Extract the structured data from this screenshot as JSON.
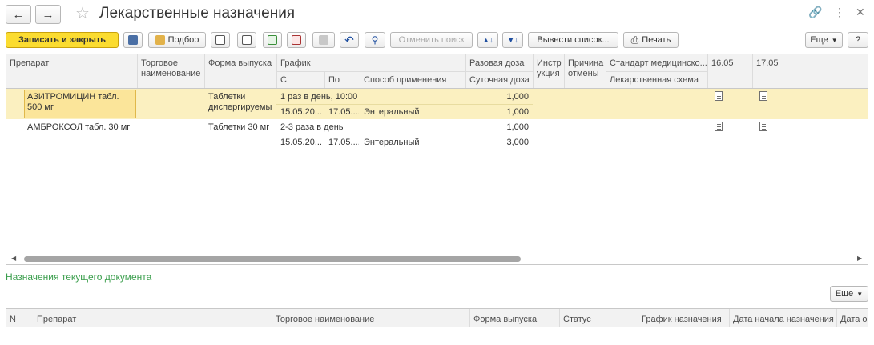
{
  "window": {
    "title": "Лекарственные назначения",
    "back_icon": "arrow-left",
    "forward_icon": "arrow-right",
    "link_icon": "link",
    "menu_icon": "kebab",
    "close_icon": "close"
  },
  "toolbar": {
    "save_close": "Записать и закрыть",
    "podbor": "Подбор",
    "cancel_search": "Отменить поиск",
    "show_list": "Вывести список...",
    "print": "Печать",
    "more": "Еще",
    "help": "?"
  },
  "main_table": {
    "headers": {
      "drug": "Препарат",
      "trade_name": "Торговое наименование",
      "form": "Форма выпуска",
      "schedule": "График",
      "from": "С",
      "to": "По",
      "method": "Способ применения",
      "single_dose": "Разовая доза",
      "daily_dose": "Суточная доза",
      "instruction": "Инстр укция",
      "cancel_reason": "Причина отмены",
      "standard": "Стандарт медицинско...",
      "drug_scheme": "Лекарственная схема",
      "date1": "16.05",
      "date2": "17.05"
    },
    "rows": [
      {
        "drug": "АЗИТРОМИЦИН табл. 500 мг",
        "form": "Таблетки диспергируемы",
        "schedule": "1 раз в день, 10:00",
        "from": "15.05.20...",
        "to": "17.05....",
        "method": "Энтеральный",
        "single_dose": "1,000",
        "daily_dose": "1,000"
      },
      {
        "drug": "АМБРОКСОЛ табл. 30 мг",
        "form": "Таблетки 30 мг",
        "schedule": "2-3 раза в день",
        "from": "15.05.20...",
        "to": "17.05....",
        "method": "Энтеральный",
        "single_dose": "1,000",
        "daily_dose": "3,000"
      }
    ]
  },
  "section_title": "Назначения текущего документа",
  "second_table": {
    "more": "Еще",
    "headers": [
      "N",
      "Препарат",
      "Торговое наименование",
      "Форма выпуска",
      "Статус",
      "График назначения",
      "Дата начала назначения",
      "Дата о"
    ]
  },
  "colors": {
    "accent_yellow": "#fbdc30",
    "selected_row": "#fbf0c0",
    "section_green": "#3a9e4c"
  }
}
